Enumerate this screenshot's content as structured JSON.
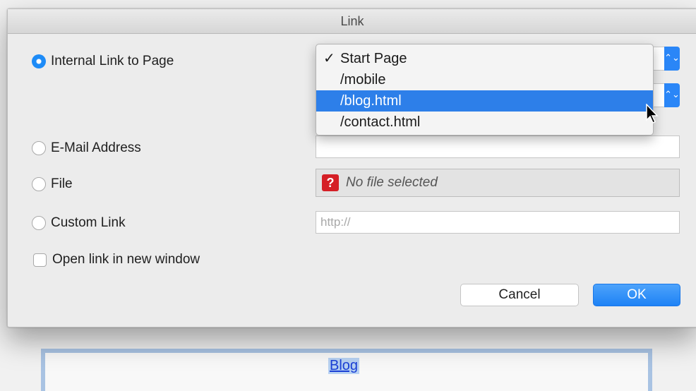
{
  "dialog": {
    "title": "Link",
    "options": {
      "internal": "Internal Link to Page",
      "email": "E-Mail Address",
      "file": "File",
      "custom": "Custom Link"
    },
    "new_window_label": "Open link in new window",
    "file_status": "No file selected",
    "custom_placeholder": "http://",
    "cancel_label": "Cancel",
    "ok_label": "OK"
  },
  "page_menu": {
    "items": [
      "Start Page",
      "/mobile",
      "/blog.html",
      "/contact.html"
    ],
    "checked_item": "Start Page",
    "highlighted_item": "/blog.html",
    "check_mark": "✓"
  },
  "background_page": {
    "link_text": "Blog"
  },
  "icons": {
    "file_icon": "question-mark-icon",
    "file_icon_glyph": "?",
    "stepper_glyph": "⌃⌄"
  },
  "colors": {
    "accent": "#1e82f5",
    "menu_highlight": "#2d7fe9",
    "file_icon_bg": "#d51f26",
    "link": "#1a3fd6"
  }
}
